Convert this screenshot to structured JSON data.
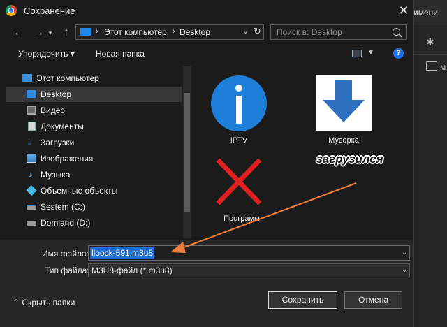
{
  "background": {
    "fragment_top": "имени",
    "fragment_folder": "м"
  },
  "dialog": {
    "title": "Сохранение",
    "close": "✕"
  },
  "nav": {
    "back": "←",
    "forward": "→",
    "up": "↑",
    "breadcrumb": [
      "Этот компьютер",
      "Desktop"
    ],
    "search_placeholder": "Поиск в: Desktop"
  },
  "toolbar": {
    "organize": "Упорядочить ▾",
    "new_folder": "Новая папка",
    "help": "?"
  },
  "sidebar": {
    "items": [
      {
        "label": "Этот компьютер",
        "icon": "computer-icon"
      },
      {
        "label": "Desktop",
        "icon": "desktop-icon",
        "selected": true
      },
      {
        "label": "Видео",
        "icon": "video-icon"
      },
      {
        "label": "Документы",
        "icon": "documents-icon"
      },
      {
        "label": "Загрузки",
        "icon": "downloads-icon"
      },
      {
        "label": "Изображения",
        "icon": "images-icon"
      },
      {
        "label": "Музыка",
        "icon": "music-icon"
      },
      {
        "label": "Объемные объекты",
        "icon": "3d-objects-icon"
      },
      {
        "label": "Sestem (C:)",
        "icon": "drive-c-icon"
      },
      {
        "label": "Domland (D:)",
        "icon": "drive-d-icon"
      }
    ]
  },
  "files": [
    {
      "label": "IPTV",
      "icon": "info-icon"
    },
    {
      "label": "Мусорка",
      "icon": "down-arrow-icon"
    },
    {
      "label": "Програмы",
      "icon": "red-x-icon"
    }
  ],
  "form": {
    "filename_label": "Имя файла:",
    "filename_value": "lloock-591.m3u8",
    "filetype_label": "Тип файла:",
    "filetype_value": "M3U8-файл (*.m3u8)",
    "hide_folders": "⌃  Скрыть папки",
    "save": "Сохранить",
    "cancel": "Отмена"
  },
  "annotation": {
    "text": "загрузился",
    "arrow_color": "#f07c3a"
  }
}
